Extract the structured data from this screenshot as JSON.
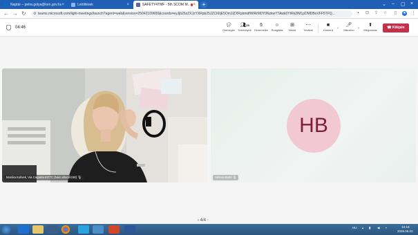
{
  "browser": {
    "tabs": [
      {
        "label": "Naptár – petra.golya@ken.gov.hu",
        "favicon_color": "#0f6cbd",
        "active": false
      },
      {
        "label": "Letöltések",
        "favicon_color": "#8ab4f8",
        "active": false
      },
      {
        "label": "SAFETY4TMF - 5th SCOM M...",
        "favicon_color": "#6264a7",
        "active": true
      }
    ],
    "url": "teams.microsoft.com/light-meetings/launch?agent=web&version=25042109600&coords=eyJjb25zZXJzYXRpb25JZCI6IjE5Om1lZXRpbmdfWlRrM0Y0NzkwYTAwk0YtRkZlM1pDMDBoVFF5TFQ..."
  },
  "meeting": {
    "timer": "04:46",
    "controls": [
      {
        "label": "Csevegés",
        "icon": "chat-icon"
      },
      {
        "label": "Személyek",
        "icon": "people-icon",
        "count": "28"
      },
      {
        "label": "Kézemelés",
        "icon": "raise-hand-icon"
      },
      {
        "label": "Reagálás",
        "icon": "react-icon"
      },
      {
        "label": "Nézet",
        "icon": "view-icon"
      },
      {
        "label": "További",
        "icon": "more-icon"
      },
      {
        "label": "Kamera",
        "icon": "camera-icon"
      },
      {
        "label": "Mikrofon",
        "icon": "microphone-icon"
      },
      {
        "label": "Megosztás",
        "icon": "share-icon"
      }
    ],
    "leave_label": "Kilépés"
  },
  "participants": [
    {
      "name": "Monika Kollvek, Via Carpatia EGTC (Nem ellenőrzött)",
      "type": "video"
    },
    {
      "name": "Helena Boltě",
      "initials": "HB",
      "type": "avatar"
    }
  ],
  "pager": "4/4",
  "taskbar": {
    "tray_lang": "HU",
    "time": "10:19",
    "date": "2025.06.02."
  },
  "colors": {
    "accent": "#6264a7",
    "leave": "#c4314b",
    "avatar_bg": "#f2c8d3",
    "avatar_fg": "#7a1e3a"
  }
}
